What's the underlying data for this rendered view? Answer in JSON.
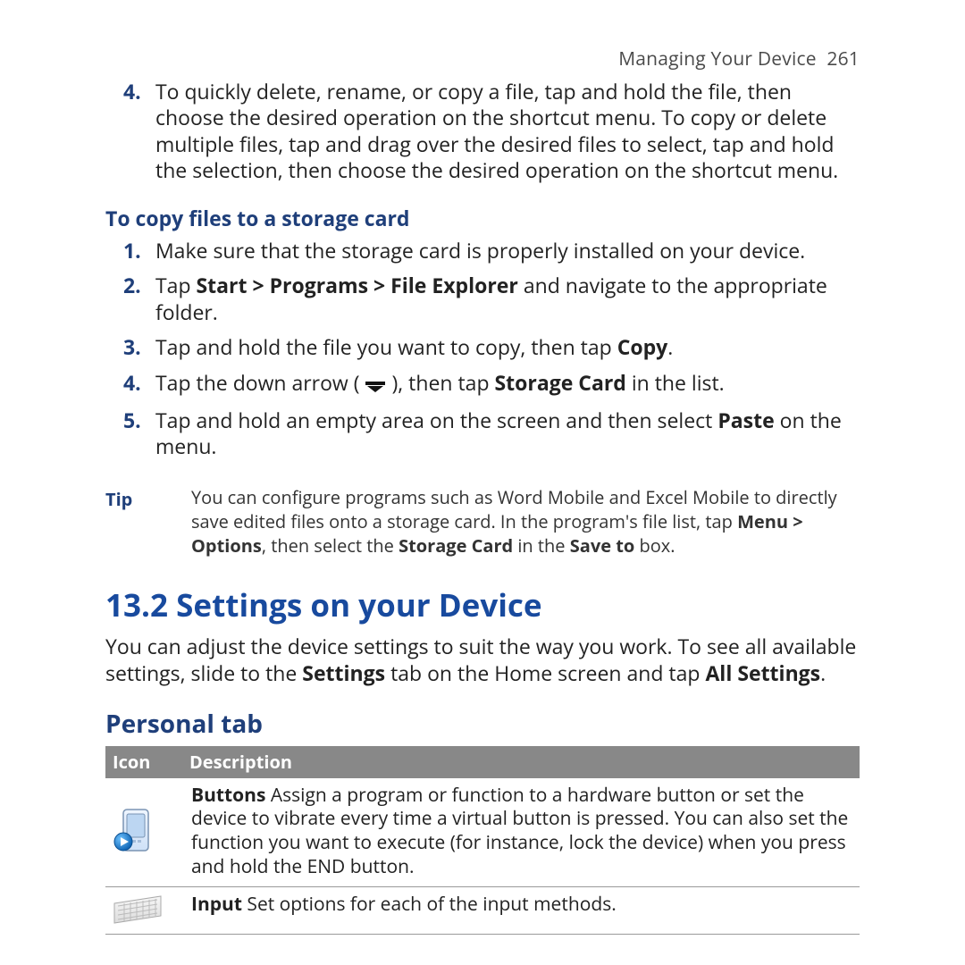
{
  "header": {
    "title": "Managing Your Device",
    "page_number": "261"
  },
  "step4_text": "To quickly delete, rename, or copy a file, tap and hold the file, then choose the desired operation on the shortcut menu. To copy or delete multiple files, tap and drag over the desired files to select, tap and hold the selection, then choose the desired operation on the shortcut menu.",
  "copy_heading": "To copy files to a storage card",
  "copy_steps": {
    "s1": "Make sure that the storage card is properly installed on your device.",
    "s2_pre": "Tap ",
    "s2_bold": "Start > Programs > File Explorer",
    "s2_post": " and navigate to the appropriate folder.",
    "s3_pre": "Tap and hold the file you want to copy, then tap ",
    "s3_bold": "Copy",
    "s3_post": ".",
    "s4_pre": "Tap the down arrow (",
    "s4_mid": "), then tap ",
    "s4_bold": "Storage Card",
    "s4_post": " in the list.",
    "s5_pre": "Tap and hold an empty area on the screen and then select ",
    "s5_bold": "Paste",
    "s5_post": " on the menu."
  },
  "tip": {
    "label": "Tip",
    "t1": "You can configure programs such as Word Mobile and Excel Mobile to directly save edited files onto a storage card. In the program's file list, tap ",
    "t_bold1": "Menu > Options",
    "t_mid": ", then select the ",
    "t_bold2": "Storage Card",
    "t_mid2": " in the ",
    "t_bold3": "Save to",
    "t_post": " box."
  },
  "section": {
    "title": "13.2  Settings on your Device",
    "body_pre": "You can adjust the device settings to suit the way you work. To see all available settings, slide to the ",
    "body_bold1": "Settings",
    "body_mid": " tab on the Home screen and tap ",
    "body_bold2": "All Settings",
    "body_post": "."
  },
  "personal": {
    "heading": "Personal tab",
    "col_icon": "Icon",
    "col_desc": "Description",
    "row1": {
      "bold": "Buttons",
      "text": "  Assign a program or function to a hardware button or set the device to vibrate every time a virtual button is pressed. You can also set the function you want to execute (for instance, lock the device) when you press and hold the END button."
    },
    "row2": {
      "bold": "Input",
      "text": "  Set options for each of the input methods."
    }
  }
}
